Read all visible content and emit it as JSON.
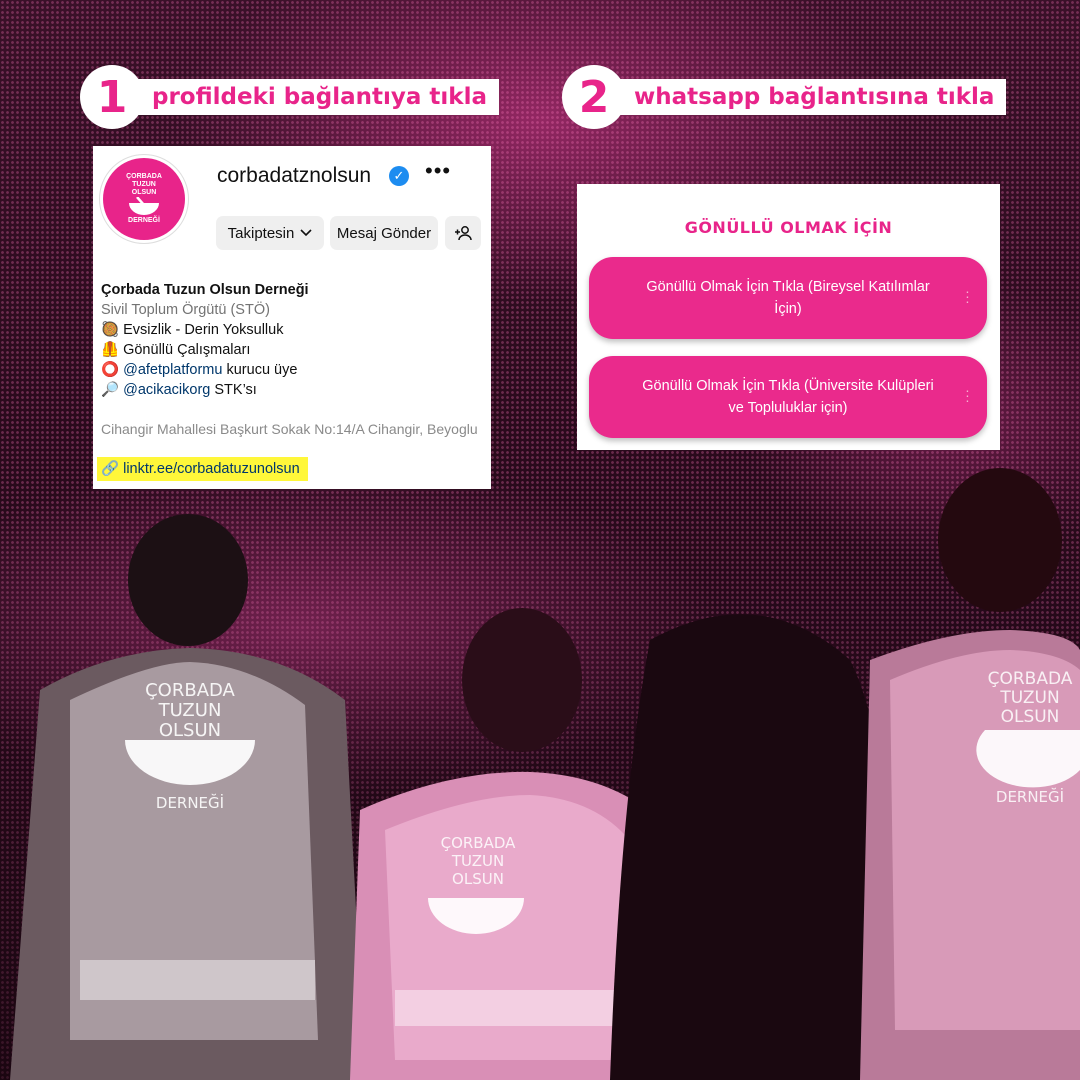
{
  "steps": [
    {
      "number": "1",
      "label": "profildeki bağlantıya tıkla"
    },
    {
      "number": "2",
      "label": "whatsapp bağlantısına tıkla"
    }
  ],
  "instagram": {
    "avatar_text": [
      "ÇORBADA",
      "TUZUN",
      "OLSUN",
      "DERNEĞİ"
    ],
    "username": "corbadatznolsun",
    "more_icon": "•••",
    "follow_button": "Takiptesin",
    "message_button": "Mesaj Gönder",
    "bio_name": "Çorbada Tuzun Olsun Derneği",
    "bio_category": "Sivil Toplum Örgütü (STÖ)",
    "bio_lines": [
      {
        "emoji": "🥘",
        "text": "Evsizlik - Derin Yoksulluk"
      },
      {
        "emoji": "🦺",
        "text": "Gönüllü Çalışmaları"
      },
      {
        "emoji": "⭕",
        "mention": "@afetplatformu",
        "text": " kurucu üye"
      },
      {
        "emoji": "🔎",
        "mention": "@acikacikorg",
        "text": " STK’sı"
      }
    ],
    "address": "Cihangir Mahallesi Başkurt Sokak No:14/A Cihangir, Beyoglu",
    "link": "linktr.ee/corbadatuzunolsun"
  },
  "linktree": {
    "title": "GÖNÜLLÜ OLMAK İÇİN",
    "buttons": [
      "Gönüllü Olmak İçin Tıkla (Bireysel Katılımlar İçin)",
      "Gönüllü Olmak İçin Tıkla (Üniversite Kulüpleri ve Topluluklar için)"
    ]
  },
  "vest_text": [
    "ÇORBADA",
    "TUZUN",
    "OLSUN",
    "DERNEĞİ"
  ],
  "colors": {
    "accent": "#e8248a",
    "highlight": "#fff73a",
    "verified": "#1d8cf0"
  }
}
